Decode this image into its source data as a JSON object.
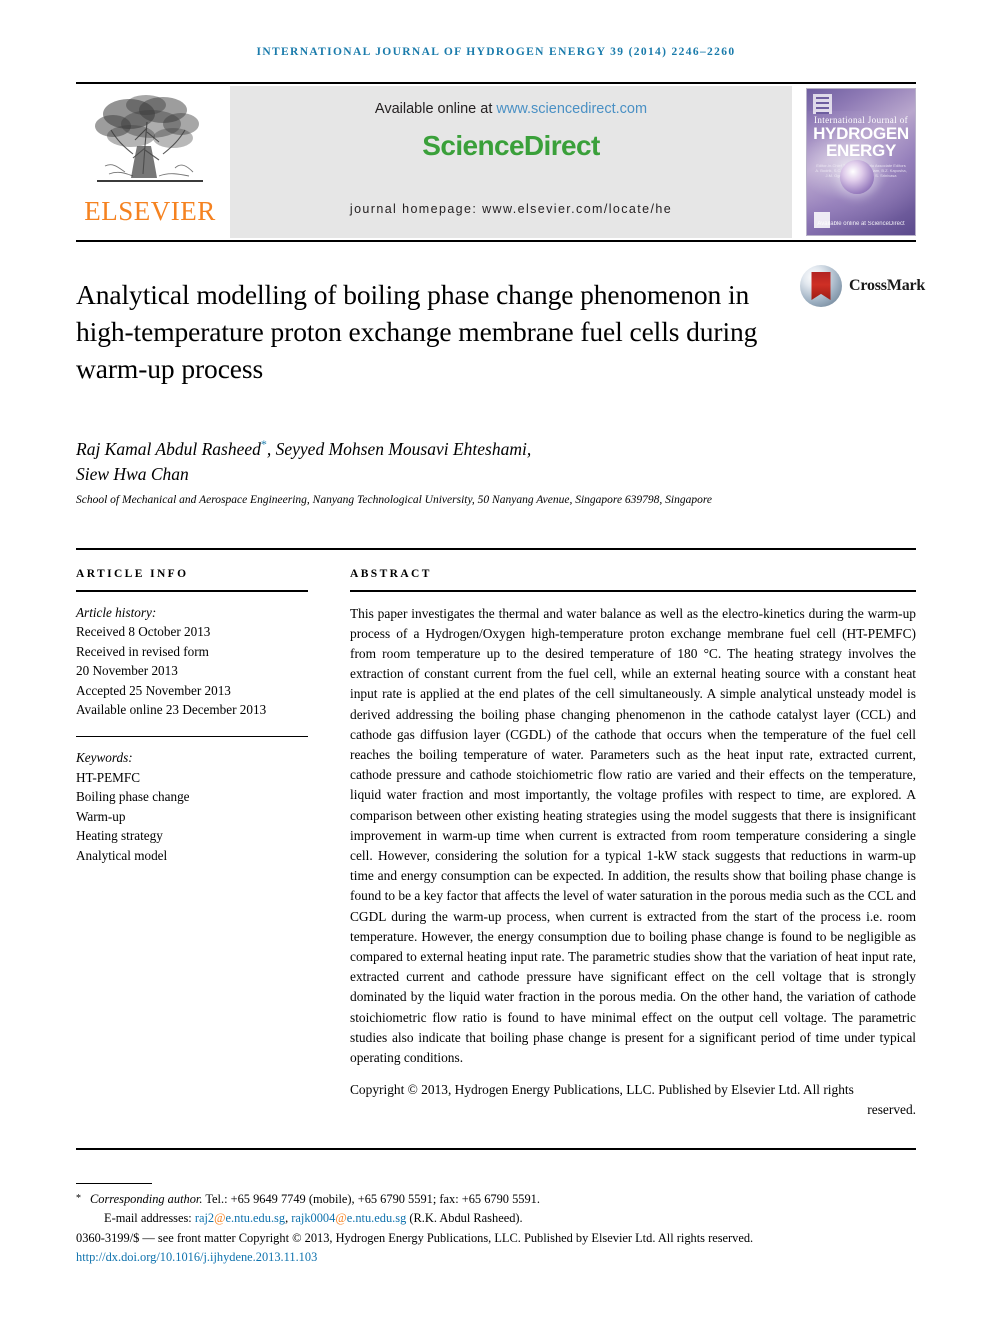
{
  "running_head": "International Journal of Hydrogen Energy 39 (2014) 2246–2260",
  "masthead": {
    "publisher_logo_text": "ELSEVIER",
    "available_prefix": "Available online at ",
    "available_url": "www.sciencedirect.com",
    "sciencedirect_logo": "ScienceDirect",
    "journal_homepage": "journal homepage: www.elsevier.com/locate/he",
    "cover": {
      "title_small": "International Journal of",
      "title_line1": "HYDROGEN",
      "title_line2": "ENERGY",
      "editors": "Editor-in-Chief  T. Nejat Veziroglu    Associate Editors  A. Bodrik, S.C. Cardoso, M.R. Islam, B.Z. Kaposha, J.M. Ogden, C.E. Tho Land S. Srinivasa",
      "footer_text": "Available online at ScienceDirect"
    }
  },
  "article": {
    "title": "Analytical modelling of boiling phase change phenomenon in high-temperature proton exchange membrane fuel cells during warm-up process",
    "crossmark_label": "CrossMark",
    "authors": "Raj Kamal Abdul Rasheed*, Seyyed Mohsen Mousavi Ehteshami, Siew Hwa Chan",
    "authors_line1_pre": "Raj Kamal Abdul Rasheed",
    "authors_star": "*",
    "authors_line1_post": ", Seyyed Mohsen Mousavi Ehteshami,",
    "authors_line2": "Siew Hwa Chan",
    "affiliation": "School of Mechanical and Aerospace Engineering, Nanyang Technological University, 50 Nanyang Avenue, Singapore 639798, Singapore"
  },
  "article_info": {
    "label": "ARTICLE INFO",
    "history_label": "Article history:",
    "history": [
      "Received 8 October 2013",
      "Received in revised form",
      "20 November 2013",
      "Accepted 25 November 2013",
      "Available online 23 December 2013"
    ],
    "keywords_label": "Keywords:",
    "keywords": [
      "HT-PEMFC",
      "Boiling phase change",
      "Warm-up",
      "Heating strategy",
      "Analytical model"
    ]
  },
  "abstract": {
    "label": "ABSTRACT",
    "body": "This paper investigates the thermal and water balance as well as the electro-kinetics during the warm-up process of a Hydrogen/Oxygen high-temperature proton exchange membrane fuel cell (HT-PEMFC) from room temperature up to the desired temperature of 180 °C. The heating strategy involves the extraction of constant current from the fuel cell, while an external heating source with a constant heat input rate is applied at the end plates of the cell simultaneously. A simple analytical unsteady model is derived addressing the boiling phase changing phenomenon in the cathode catalyst layer (CCL) and cathode gas diffusion layer (CGDL) of the cathode that occurs when the temperature of the fuel cell reaches the boiling temperature of water. Parameters such as the heat input rate, extracted current, cathode pressure and cathode stoichiometric flow ratio are varied and their effects on the temperature, liquid water fraction and most importantly, the voltage profiles with respect to time, are explored. A comparison between other existing heating strategies using the model suggests that there is insignificant improvement in warm-up time when current is extracted from room temperature considering a single cell. However, considering the solution for a typical 1-kW stack suggests that reductions in warm-up time and energy consumption can be expected. In addition, the results show that boiling phase change is found to be a key factor that affects the level of water saturation in the porous media such as the CCL and CGDL during the warm-up process, when current is extracted from the start of the process i.e. room temperature. However, the energy consumption due to boiling phase change is found to be negligible as compared to external heating input rate. The parametric studies show that the variation of heat input rate, extracted current and cathode pressure have significant effect on the cell voltage that is strongly dominated by the liquid water fraction in the porous media. On the other hand, the variation of cathode stoichiometric flow ratio is found to have minimal effect on the output cell voltage. The parametric studies also indicate that boiling phase change is present for a significant period of time under typical operating conditions.",
    "copyright_line": "Copyright © 2013, Hydrogen Energy Publications, LLC. Published by Elsevier Ltd. All rights",
    "copyright_line2": "reserved."
  },
  "footnotes": {
    "star": "*",
    "corresponding_italic": "Corresponding author.",
    "corresponding_rest": " Tel.: +65 9649 7749 (mobile), +65 6790 5591; fax: +65 6790 5591.",
    "email_label": "E-mail addresses: ",
    "email1_user": "raj2",
    "email1_at": "@",
    "email1_domain": "e.ntu.edu.sg",
    "email_sep": ", ",
    "email2_user": "rajk0004",
    "email2_at": "@",
    "email2_domain": "e.ntu.edu.sg",
    "email_attrib": " (R.K. Abdul Rasheed).",
    "imprint": "0360-3199/$ — see front matter Copyright © 2013, Hydrogen Energy Publications, LLC. Published by Elsevier Ltd. All rights reserved.",
    "doi": "http://dx.doi.org/10.1016/j.ijhydene.2013.11.103"
  },
  "colors": {
    "running_head": "#1a7bab",
    "elsevier_orange": "#F58220",
    "sciencedirect_green": "#3aa03a",
    "link_blue": "#0f72ad",
    "banner_gray": "#e6e6e6"
  }
}
